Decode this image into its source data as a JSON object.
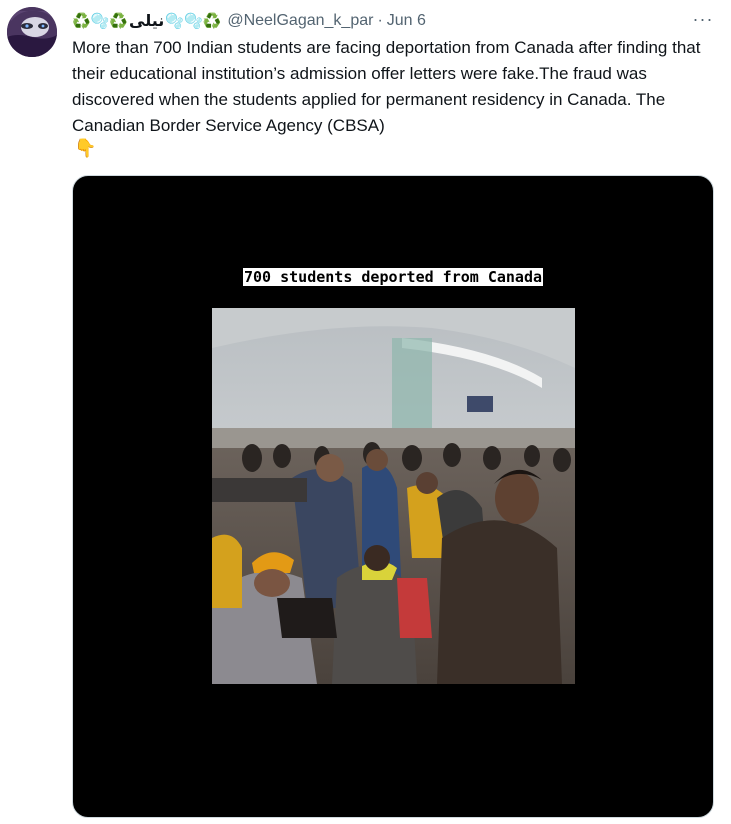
{
  "tweet": {
    "display_name": "نیلی",
    "display_name_emoji_left": "♻️🫧♻️",
    "display_name_emoji_right": "🫧🫧♻️",
    "handle": "@NeelGagan_k_par",
    "separator": "·",
    "date": "Jun 6",
    "more_label": "···",
    "text": "More than 700 Indian students are facing deportation from Canada after finding that their educational institution’s admission offer letters were fake.The fraud was discovered when the students applied for permanent residency in Canada. The Canadian Border Service Agency (CBSA)",
    "trailing_emoji": "👇"
  },
  "media": {
    "caption": "700 students deported from Canada"
  },
  "colors": {
    "text_primary": "#0f1419",
    "text_secondary": "#536471",
    "media_background": "#000000",
    "border": "#cfd9de"
  }
}
